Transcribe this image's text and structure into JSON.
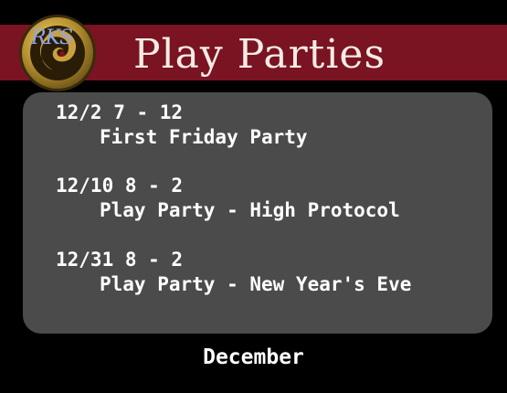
{
  "header": {
    "title": "Play Parties",
    "logo_text": "RKS",
    "banner_color": "#7a1322"
  },
  "events": [
    {
      "when": "12/2 7 - 12",
      "what": "First Friday Party"
    },
    {
      "when": "12/10 8 - 2",
      "what": "Play Party - High Protocol"
    },
    {
      "when": "12/31 8 - 2",
      "what": "Play Party - New Year's Eve"
    }
  ],
  "footer": {
    "month": "December"
  }
}
